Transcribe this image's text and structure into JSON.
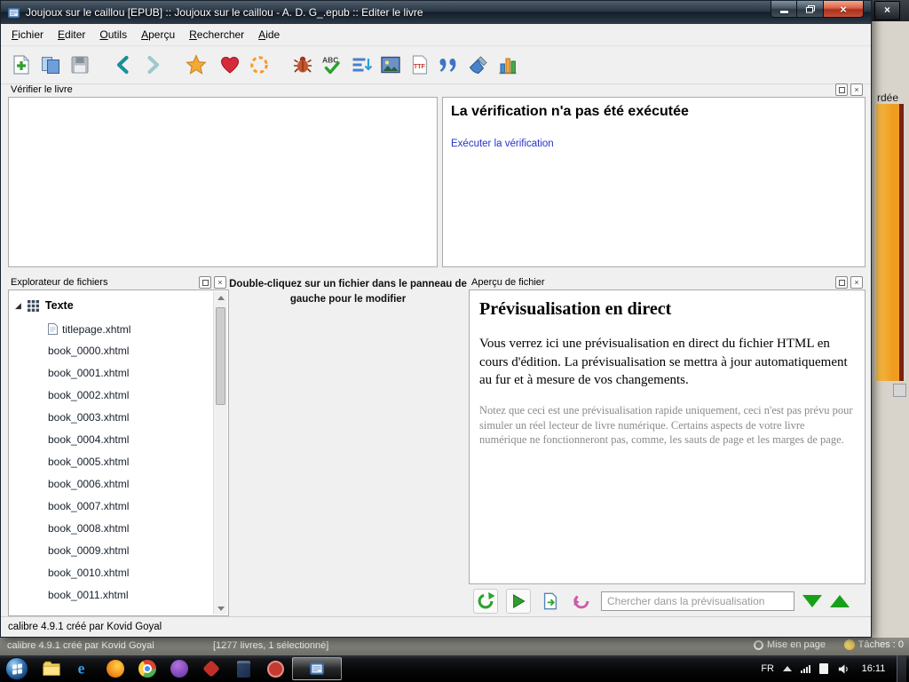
{
  "window": {
    "title": "Joujoux sur le caillou [EPUB] :: Joujoux sur le caillou - A. D. G_.epub :: Editer le livre"
  },
  "menu": {
    "items": [
      "Fichier",
      "Editer",
      "Outils",
      "Aperçu",
      "Rechercher",
      "Aide"
    ]
  },
  "toolbar": {
    "buttons": [
      "new-file",
      "open-file",
      "save-file",
      "back",
      "forward",
      "bookmark",
      "donate",
      "sync",
      "check-book",
      "spellcheck",
      "beautify",
      "insert-image",
      "insert-font",
      "insert-quote",
      "clean-style",
      "reports"
    ]
  },
  "checker": {
    "panel_title": "Vérifier le livre",
    "heading": "La vérification n'a pas été exécutée",
    "run_link": "Exécuter la vérification"
  },
  "explorer": {
    "panel_title": "Explorateur de fichiers",
    "group": "Texte",
    "titlepage": "titlepage.xhtml",
    "files": [
      "book_0000.xhtml",
      "book_0001.xhtml",
      "book_0002.xhtml",
      "book_0003.xhtml",
      "book_0004.xhtml",
      "book_0005.xhtml",
      "book_0006.xhtml",
      "book_0007.xhtml",
      "book_0008.xhtml",
      "book_0009.xhtml",
      "book_0010.xhtml",
      "book_0011.xhtml"
    ]
  },
  "editor_hint": "Double-cliquez sur un fichier dans le panneau de gauche pour le modifier",
  "preview": {
    "panel_title": "Aperçu de fichier",
    "heading": "Prévisualisation en direct",
    "body": "Vous verrez ici une prévisualisation en direct du fichier HTML en cours d'édition. La prévisualisation se mettra à jour automatiquement au fur et à mesure de vos changements.",
    "note": "Notez que ceci est une prévisualisation rapide uniquement, ceci n'est pas prévu pour simuler un réel lecteur de livre numérique. Certains aspects de votre livre numérique ne fonctionneront pas, comme, les sauts de page et les marges de page.",
    "search_placeholder": "Chercher dans la prévisualisation",
    "toolbar_buttons": [
      "refresh-preview",
      "launch-preview",
      "reload-file",
      "sync-position",
      "search",
      "find-next",
      "find-previous"
    ]
  },
  "statusbar": {
    "text": "calibre 4.9.1 créé par Kovid Goyal"
  },
  "background_window": {
    "fragment_top": "rdée",
    "status_left": "calibre 4.9.1 créé par Kovid Goyal",
    "status_count": "[1277 livres, 1 sélectionné]",
    "layout_label": "Mise en page",
    "tasks_label": "Tâches : 0",
    "close_glyph": "×"
  },
  "taskbar": {
    "language": "FR",
    "time": "16:11",
    "apps": [
      "explorer-folder",
      "internet-explorer",
      "firefox",
      "chrome",
      "opera",
      "red-app",
      "calibre-library",
      "red-flower-app",
      "calibre-editor-active"
    ]
  },
  "colors": {
    "link_blue": "#2433cc",
    "cover_orange": "#f09d20",
    "close_red": "#ad301a",
    "green_accent": "#18a018"
  }
}
